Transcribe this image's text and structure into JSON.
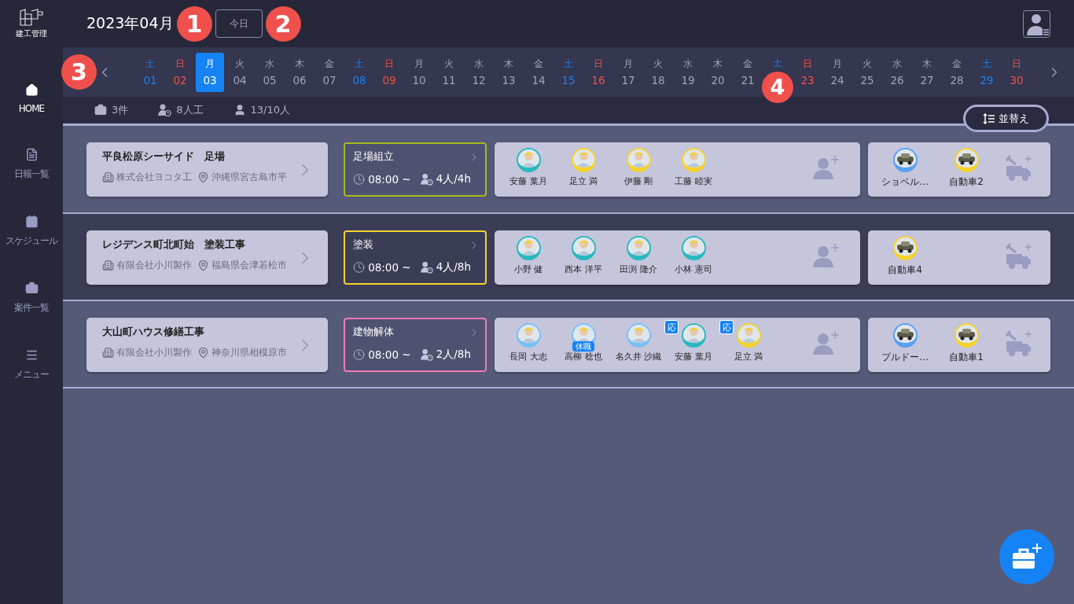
{
  "app": {
    "logo_text": "建工管理"
  },
  "header": {
    "month": "2023年04月",
    "today_button": "今日",
    "callouts": [
      "1",
      "2"
    ]
  },
  "sidebar": {
    "items": [
      {
        "label": "HOME",
        "selected": true
      },
      {
        "label": "日報一覧",
        "selected": false
      },
      {
        "label": "スケジュール",
        "selected": false
      },
      {
        "label": "案件一覧",
        "selected": false
      },
      {
        "label": "メニュー",
        "selected": false
      }
    ]
  },
  "date_strip": {
    "callout": "3",
    "days": [
      {
        "weekday": "土",
        "date": "01",
        "kind": "sat",
        "selected": false
      },
      {
        "weekday": "日",
        "date": "02",
        "kind": "sun",
        "selected": false
      },
      {
        "weekday": "月",
        "date": "03",
        "kind": "weekday",
        "selected": true
      },
      {
        "weekday": "火",
        "date": "04",
        "kind": "weekday",
        "selected": false
      },
      {
        "weekday": "水",
        "date": "05",
        "kind": "weekday",
        "selected": false
      },
      {
        "weekday": "木",
        "date": "06",
        "kind": "weekday",
        "selected": false
      },
      {
        "weekday": "金",
        "date": "07",
        "kind": "weekday",
        "selected": false
      },
      {
        "weekday": "土",
        "date": "08",
        "kind": "sat",
        "selected": false
      },
      {
        "weekday": "日",
        "date": "09",
        "kind": "sun",
        "selected": false
      },
      {
        "weekday": "月",
        "date": "10",
        "kind": "weekday",
        "selected": false
      },
      {
        "weekday": "火",
        "date": "11",
        "kind": "weekday",
        "selected": false
      },
      {
        "weekday": "水",
        "date": "12",
        "kind": "weekday",
        "selected": false
      },
      {
        "weekday": "木",
        "date": "13",
        "kind": "weekday",
        "selected": false
      },
      {
        "weekday": "金",
        "date": "14",
        "kind": "weekday",
        "selected": false
      },
      {
        "weekday": "土",
        "date": "15",
        "kind": "sat",
        "selected": false
      },
      {
        "weekday": "日",
        "date": "16",
        "kind": "sun",
        "selected": false
      },
      {
        "weekday": "月",
        "date": "17",
        "kind": "weekday",
        "selected": false
      },
      {
        "weekday": "火",
        "date": "18",
        "kind": "weekday",
        "selected": false
      },
      {
        "weekday": "水",
        "date": "19",
        "kind": "weekday",
        "selected": false
      },
      {
        "weekday": "木",
        "date": "20",
        "kind": "weekday",
        "selected": false
      },
      {
        "weekday": "金",
        "date": "21",
        "kind": "weekday",
        "selected": false
      },
      {
        "weekday": "土",
        "kind": "sat",
        "selected": false,
        "callout": "4"
      },
      {
        "weekday": "日",
        "date": "23",
        "kind": "sun",
        "selected": false
      },
      {
        "weekday": "月",
        "date": "24",
        "kind": "weekday",
        "selected": false
      },
      {
        "weekday": "火",
        "date": "25",
        "kind": "weekday",
        "selected": false
      },
      {
        "weekday": "水",
        "date": "26",
        "kind": "weekday",
        "selected": false
      },
      {
        "weekday": "木",
        "date": "27",
        "kind": "weekday",
        "selected": false
      },
      {
        "weekday": "金",
        "date": "28",
        "kind": "weekday",
        "selected": false
      },
      {
        "weekday": "土",
        "date": "29",
        "kind": "sat",
        "selected": false
      },
      {
        "weekday": "日",
        "date": "30",
        "kind": "sun",
        "selected": false
      }
    ]
  },
  "summary": {
    "projects": "3件",
    "man_days": "8人工",
    "people": "13/10人",
    "sort_button": "並替え"
  },
  "projects": [
    {
      "name": "平良松原シーサイド　足場",
      "company": "株式会社ヨコタ工",
      "address": "沖縄県宮古島市平",
      "highlighted": false,
      "task": {
        "name": "足場組立",
        "color": "#a8b820",
        "time": "08:00 ~",
        "crew": "4人/4h"
      },
      "members": [
        {
          "name": "安藤 葉月",
          "color": "#2ab8c0"
        },
        {
          "name": "足立 満",
          "color": "#f5d230"
        },
        {
          "name": "伊藤 剛",
          "color": "#f5d230"
        },
        {
          "name": "工藤 睦実",
          "color": "#f5d230"
        }
      ],
      "equipment": [
        {
          "name": "ショベル…",
          "color": "#5aa0f0"
        },
        {
          "name": "自動車2",
          "color": "#f5d230"
        }
      ]
    },
    {
      "name": "レジデンス町北町始　塗装工事",
      "company": "有限会社小川製作",
      "address": "福島県会津若松市",
      "highlighted": true,
      "task": {
        "name": "塗装",
        "color": "#f5d230",
        "time": "08:00 ~",
        "crew": "4人/8h"
      },
      "members": [
        {
          "name": "小野 健",
          "color": "#2ab8c0"
        },
        {
          "name": "西本 洋平",
          "color": "#2ab8c0"
        },
        {
          "name": "田渕 隆介",
          "color": "#2ab8c0"
        },
        {
          "name": "小林 憲司",
          "color": "#2ab8c0"
        }
      ],
      "equipment": [
        {
          "name": "自動車4",
          "color": "#f5d230"
        }
      ]
    },
    {
      "name": "大山町ハウス修繕工事",
      "company": "有限会社小川製作",
      "address": "神奈川県相模原市",
      "highlighted": false,
      "task": {
        "name": "建物解体",
        "color": "#f07ab8",
        "time": "08:00 ~",
        "crew": "2人/8h"
      },
      "members": [
        {
          "name": "長岡 大志",
          "color": "#7ac0f5"
        },
        {
          "name": "高柳 稔也",
          "color": "#7ac0f5",
          "status": "休職"
        },
        {
          "name": "名久井 沙織",
          "color": "#7ac0f5"
        },
        {
          "name": "安藤 葉月",
          "color": "#2ab8c0",
          "badge": "応"
        },
        {
          "name": "足立 満",
          "color": "#f5d230",
          "badge": "応"
        }
      ],
      "equipment": [
        {
          "name": "ブルドー…",
          "color": "#5aa0f0"
        },
        {
          "name": "自動車1",
          "color": "#f5d230"
        }
      ]
    }
  ]
}
